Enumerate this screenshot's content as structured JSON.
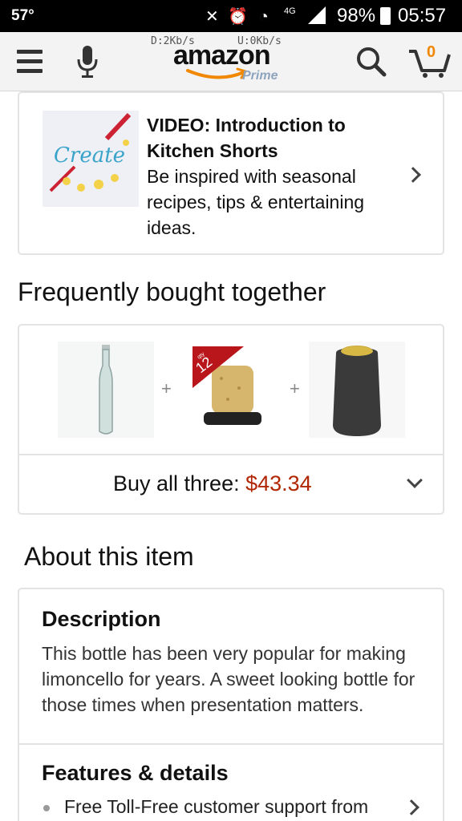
{
  "status_bar": {
    "temperature": "57°",
    "lte_label": "4G",
    "battery": "98%",
    "time": "05:57"
  },
  "header": {
    "download_speed": "D:2Kb/s",
    "upload_speed": "U:0Kb/s",
    "logo": "amazon",
    "logo_sub": "Prime",
    "cart_count": "0"
  },
  "video_card": {
    "thumbnail_text": "Create",
    "title": "VIDEO: Introduction to Kitchen Shorts",
    "description": "Be inspired with seasonal recipes, tips & entertaining ideas."
  },
  "frequently_bought": {
    "heading": "Frequently bought together",
    "products": [
      {
        "name": "Glass bottle"
      },
      {
        "name": "Cork stoppers",
        "badge_qty": "12",
        "badge_unit": "qty"
      },
      {
        "name": "Shrink capsule"
      }
    ],
    "buy_all_label": "Buy all three:",
    "buy_all_price": "$43.34"
  },
  "about": {
    "heading": "About this item",
    "description_title": "Description",
    "description_text": "This bottle has been very popular for making limoncello for years. A sweet looking bottle for those times when presentation matters.",
    "features_title": "Features & details",
    "features": [
      "Free Toll-Free customer support from"
    ]
  },
  "colors": {
    "price": "#b12704",
    "cart_count": "#f08804",
    "logo_smile": "#f08804"
  }
}
